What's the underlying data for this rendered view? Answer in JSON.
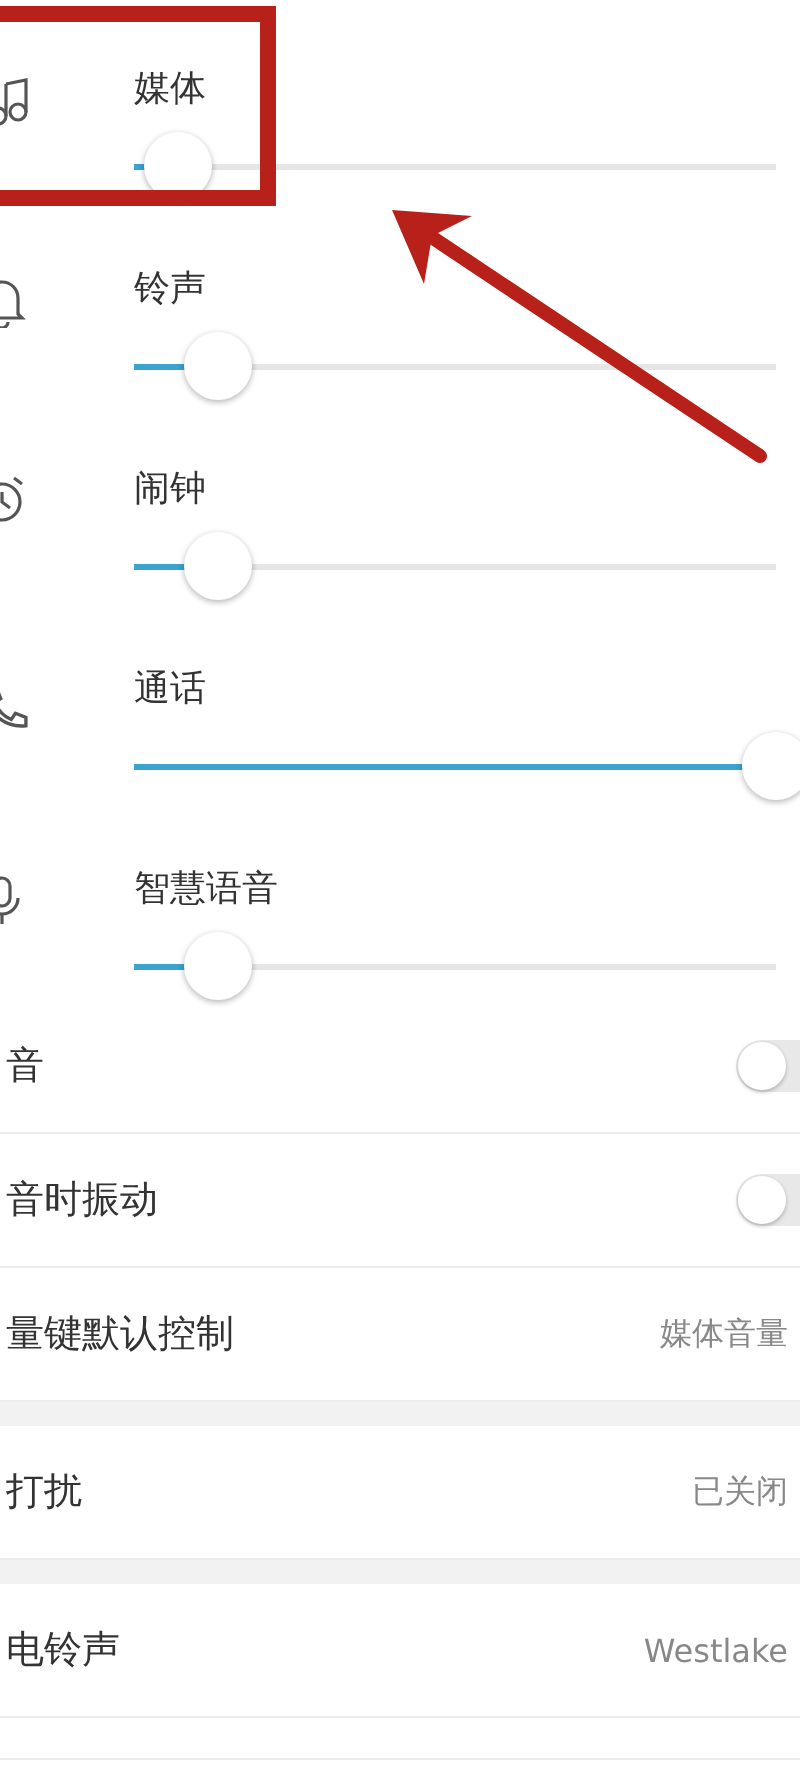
{
  "sliders": [
    {
      "kind": "music",
      "label": "媒体",
      "level": 0.07
    },
    {
      "kind": "bell",
      "label": "铃声",
      "level": 0.13
    },
    {
      "kind": "alarm",
      "label": "闹钟",
      "level": 0.13
    },
    {
      "kind": "phone",
      "label": "通话",
      "level": 1
    },
    {
      "kind": "mic",
      "label": "智慧语音",
      "level": 0.13
    }
  ],
  "settings": [
    {
      "kind": "toggle",
      "label": "音",
      "on": false
    },
    {
      "kind": "toggle",
      "label": "音时振动",
      "on": false
    },
    {
      "kind": "value",
      "label": "量键默认控制",
      "value": "媒体音量"
    },
    {
      "kind": "gap"
    },
    {
      "kind": "value",
      "label": "打扰",
      "value": "已关闭"
    },
    {
      "kind": "gap"
    },
    {
      "kind": "value",
      "label": "电铃声",
      "value": "Westlake"
    }
  ],
  "annotation": {
    "frame": true,
    "arrow": true
  }
}
